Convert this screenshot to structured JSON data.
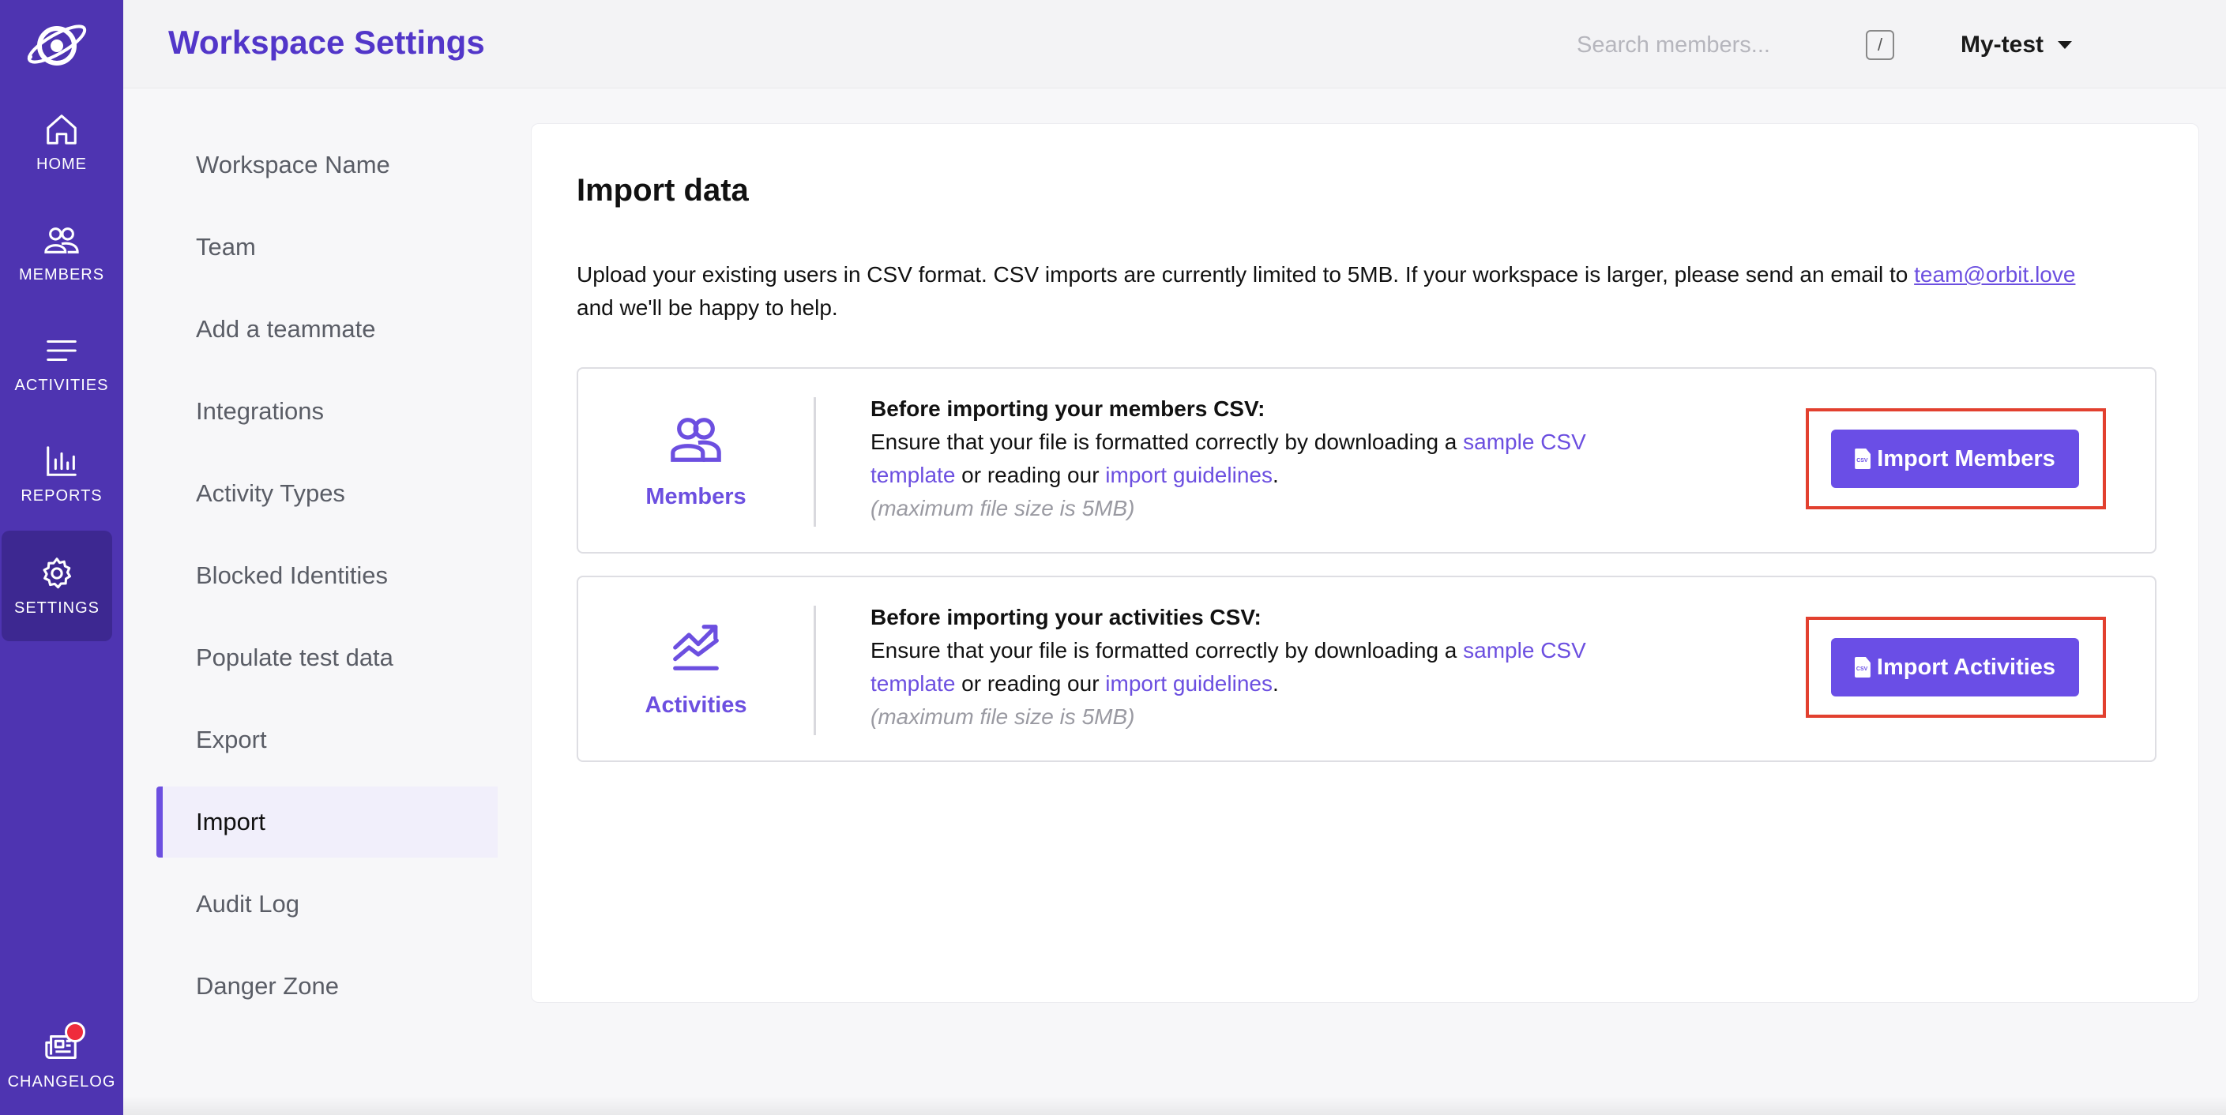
{
  "rail": {
    "logo": "orbit-logo-icon",
    "items": [
      {
        "label": "HOME",
        "icon": "home-icon"
      },
      {
        "label": "MEMBERS",
        "icon": "members-icon"
      },
      {
        "label": "ACTIVITIES",
        "icon": "activities-icon"
      },
      {
        "label": "REPORTS",
        "icon": "reports-icon"
      },
      {
        "label": "SETTINGS",
        "icon": "gear-icon",
        "active": true
      }
    ],
    "changelog": {
      "label": "CHANGELOG",
      "icon": "newspaper-icon",
      "badge_color": "#ef2c3c"
    }
  },
  "header": {
    "title": "Workspace Settings",
    "search_placeholder": "Search members...",
    "shortcut_key": "/",
    "workspace_name": "My-test"
  },
  "subnav": {
    "items": [
      "Workspace Name",
      "Team",
      "Add a teammate",
      "Integrations",
      "Activity Types",
      "Blocked Identities",
      "Populate test data",
      "Export",
      "Import",
      "Audit Log",
      "Danger Zone"
    ],
    "active": "Import"
  },
  "main": {
    "title": "Import data",
    "intro_text": "Upload your existing users in CSV format. CSV imports are currently limited to 5MB. If your workspace is larger, please send an email to ",
    "intro_email": "team@orbit.love",
    "intro_tail": "and we'll be happy to help.",
    "boxes": [
      {
        "label": "Members",
        "icon": "members-icon",
        "heading": "Before importing your members CSV:",
        "body_start": "Ensure that your file is formatted correctly by downloading a ",
        "link1": "sample CSV template",
        "body_mid": " or reading our ",
        "link2": "import guidelines",
        "body_end": ".",
        "note": "(maximum file size is 5MB)",
        "button": "Import Members",
        "button_icon": "csv-file-icon",
        "csv_tag": "CSV"
      },
      {
        "label": "Activities",
        "icon": "trending-up-icon",
        "heading": "Before importing your activities CSV:",
        "body_start": "Ensure that your file is formatted correctly by downloading a ",
        "link1": "sample CSV template",
        "body_mid": " or reading our ",
        "link2": "import guidelines",
        "body_end": ".",
        "note": "(maximum file size is 5MB)",
        "button": "Import Activities",
        "button_icon": "csv-file-icon",
        "csv_tag": "CSV"
      }
    ]
  },
  "colors": {
    "rail": "#4e34b1",
    "accent": "#6a4ee6",
    "highlight": "#e2402f"
  }
}
